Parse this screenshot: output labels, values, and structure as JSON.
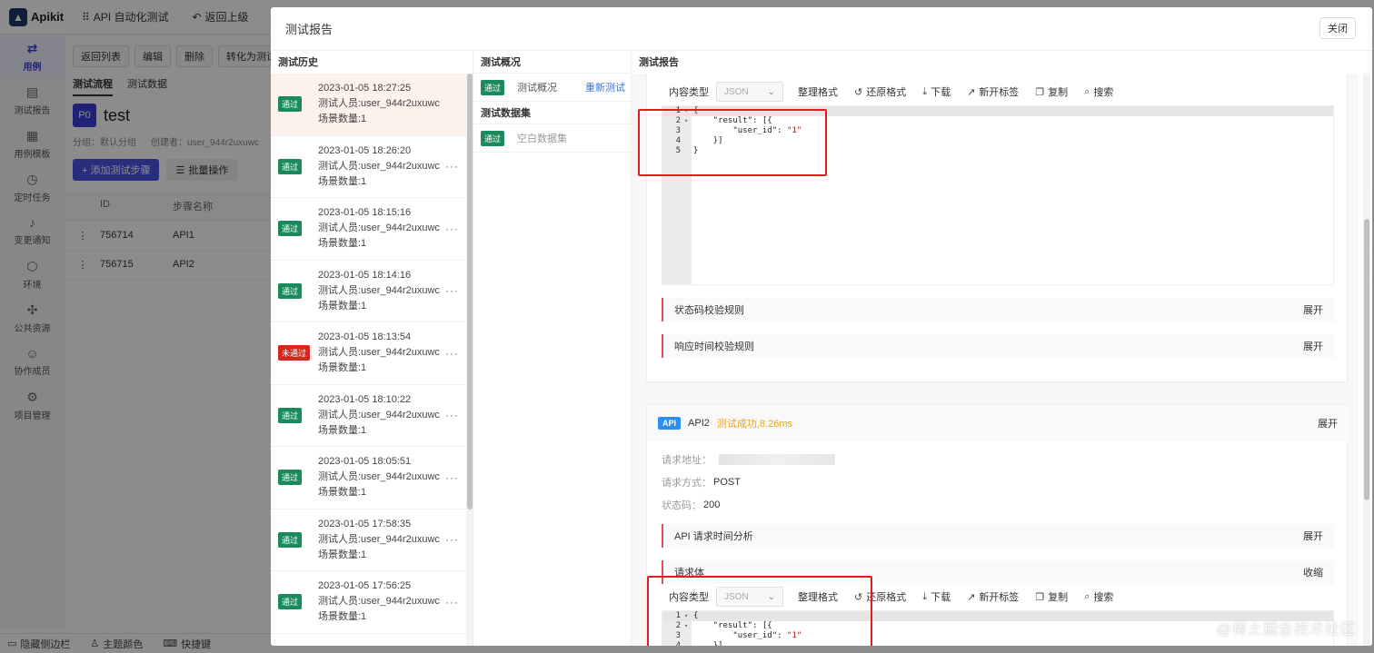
{
  "app": {
    "logo_text": "Apikit",
    "breadcrumbs": [
      {
        "icon": "grid-icon",
        "label": "API 自动化测试"
      },
      {
        "icon": "undo-icon",
        "label": "返回上级"
      }
    ],
    "sidebar": [
      {
        "icon": "swap-icon",
        "label": "用例",
        "active": true
      },
      {
        "icon": "report-icon",
        "label": "测试报告"
      },
      {
        "icon": "template-icon",
        "label": "用例模板"
      },
      {
        "icon": "clock-icon",
        "label": "定时任务"
      },
      {
        "icon": "bell-icon",
        "label": "变更通知"
      },
      {
        "icon": "cube-icon",
        "label": "环境"
      },
      {
        "icon": "puzzle-icon",
        "label": "公共资源"
      },
      {
        "icon": "users-icon",
        "label": "协作成员"
      },
      {
        "icon": "gear-icon",
        "label": "项目管理"
      }
    ],
    "toolbar": [
      "返回列表",
      "编辑",
      "删除",
      "转化为测试"
    ],
    "subtabs": [
      "测试流程",
      "测试数据"
    ],
    "project": {
      "badge": "P0",
      "name": "test",
      "group": "分组：默认分组",
      "creator": "创建者：user_944r2uxuwc"
    },
    "actions": {
      "add_step": "+ 添加测试步骤",
      "batch": "批量操作"
    },
    "steps_table": {
      "headers": [
        "ID",
        "步骤名称"
      ],
      "rows": [
        {
          "id": "756714",
          "name": "API1"
        },
        {
          "id": "756715",
          "name": "API2"
        }
      ]
    },
    "bottom": [
      {
        "icon": "sidebar-icon",
        "label": "隐藏侧边栏"
      },
      {
        "icon": "shirt-icon",
        "label": "主题颜色"
      },
      {
        "icon": "keyboard-icon",
        "label": "快捷键"
      }
    ]
  },
  "modal": {
    "title": "测试报告",
    "close": "关闭",
    "history": {
      "heading": "测试历史",
      "items": [
        {
          "status": "通过",
          "pass": true,
          "time": "2023-01-05 18:27:25",
          "tester": "测试人员:user_944r2uxuwc",
          "scenes": "场景数量:1",
          "selected": true
        },
        {
          "status": "通过",
          "pass": true,
          "time": "2023-01-05 18:26:20",
          "tester": "测试人员:user_944r2uxuwc",
          "scenes": "场景数量:1"
        },
        {
          "status": "通过",
          "pass": true,
          "time": "2023-01-05 18:15:16",
          "tester": "测试人员:user_944r2uxuwc",
          "scenes": "场景数量:1"
        },
        {
          "status": "通过",
          "pass": true,
          "time": "2023-01-05 18:14:16",
          "tester": "测试人员:user_944r2uxuwc",
          "scenes": "场景数量:1"
        },
        {
          "status": "未通过",
          "pass": false,
          "time": "2023-01-05 18:13:54",
          "tester": "测试人员:user_944r2uxuwc",
          "scenes": "场景数量:1"
        },
        {
          "status": "通过",
          "pass": true,
          "time": "2023-01-05 18:10:22",
          "tester": "测试人员:user_944r2uxuwc",
          "scenes": "场景数量:1"
        },
        {
          "status": "通过",
          "pass": true,
          "time": "2023-01-05 18:05:51",
          "tester": "测试人员:user_944r2uxuwc",
          "scenes": "场景数量:1"
        },
        {
          "status": "通过",
          "pass": true,
          "time": "2023-01-05 17:58:35",
          "tester": "测试人员:user_944r2uxuwc",
          "scenes": "场景数量:1"
        },
        {
          "status": "通过",
          "pass": true,
          "time": "2023-01-05 17:56:25",
          "tester": "测试人员:user_944r2uxuwc",
          "scenes": "场景数量:1"
        }
      ]
    },
    "overview": {
      "heading": "测试概况",
      "badge": "通过",
      "label": "测试概况",
      "rerun": "重新测试",
      "dataset_heading": "测试数据集",
      "dataset_badge": "通过",
      "dataset_label": "空白数据集"
    },
    "report": {
      "heading": "测试报告",
      "content_type_label": "内容类型",
      "content_type_value": "JSON",
      "tools": [
        {
          "icon": "code-icon",
          "label": "整理格式"
        },
        {
          "icon": "restore-icon",
          "label": "还原格式"
        },
        {
          "icon": "download-icon",
          "label": "下载"
        },
        {
          "icon": "external-link-icon",
          "label": "新开标签"
        },
        {
          "icon": "copy-icon",
          "label": "复制"
        },
        {
          "icon": "search-icon",
          "label": "搜索"
        }
      ],
      "code_lines": [
        {
          "n": "1",
          "fold": true,
          "text": "{"
        },
        {
          "n": "2",
          "fold": true,
          "text": "    \"result\": [{"
        },
        {
          "n": "3",
          "fold": false,
          "text": "        \"user_id\": ",
          "str": "\"1\""
        },
        {
          "n": "4",
          "fold": false,
          "text": "    }]"
        },
        {
          "n": "5",
          "fold": false,
          "text": "}"
        }
      ],
      "status_rule": "状态码校验规则",
      "time_rule": "响应时间校验规则",
      "expand": "展开",
      "collapse": "收缩",
      "api2": {
        "tag": "API",
        "name": "API2",
        "status": "测试成功,8.26ms",
        "url_label": "请求地址：",
        "method_label": "请求方式：",
        "method": "POST",
        "code_label": "状态码：",
        "code": "200",
        "timing": "API 请求时间分析",
        "body": "请求体"
      }
    }
  },
  "watermark": "@稀土掘金技术社区"
}
